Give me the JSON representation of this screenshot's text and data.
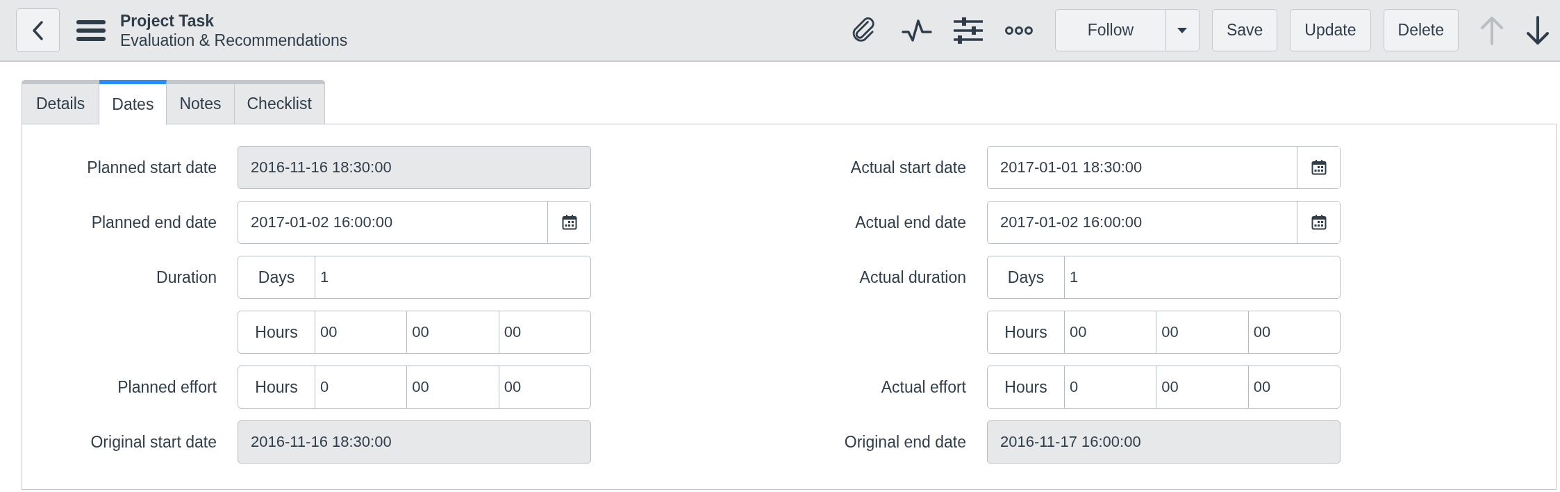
{
  "header": {
    "title": "Project Task",
    "subtitle": "Evaluation & Recommendations"
  },
  "follow": {
    "label": "Follow"
  },
  "buttons": [
    "Save",
    "Update",
    "Delete"
  ],
  "nav": [
    {
      "kind": "up",
      "disabled": true
    },
    {
      "kind": "down",
      "disabled": false
    }
  ],
  "tabs": [
    {
      "label": "Details",
      "selected": false
    },
    {
      "label": "Dates",
      "selected": true
    },
    {
      "label": "Notes",
      "selected": false
    },
    {
      "label": "Checklist",
      "selected": false
    }
  ],
  "columns": [
    {
      "rows": [
        {
          "kind": "readonly",
          "label": "Planned start date",
          "value": "2016-11-16 18:30:00"
        },
        {
          "kind": "date",
          "label": "Planned end date",
          "value": "2017-01-02 16:00:00"
        },
        {
          "kind": "days",
          "label": "Duration",
          "unit": "Days",
          "value": "1"
        },
        {
          "kind": "hours",
          "unit": "Hours",
          "values": [
            "00",
            "00",
            "00"
          ]
        },
        {
          "kind": "hours",
          "label": "Planned effort",
          "unit": "Hours",
          "values": [
            "0",
            "00",
            "00"
          ]
        },
        {
          "kind": "readonly",
          "label": "Original start date",
          "value": "2016-11-16 18:30:00"
        }
      ]
    },
    {
      "rows": [
        {
          "kind": "date",
          "label": "Actual start date",
          "value": "2017-01-01 18:30:00"
        },
        {
          "kind": "date",
          "label": "Actual end date",
          "value": "2017-01-02 16:00:00"
        },
        {
          "kind": "days",
          "label": "Actual duration",
          "unit": "Days",
          "value": "1"
        },
        {
          "kind": "hours",
          "unit": "Hours",
          "values": [
            "00",
            "00",
            "00"
          ]
        },
        {
          "kind": "hours",
          "label": "Actual effort",
          "unit": "Hours",
          "values": [
            "0",
            "00",
            "00"
          ]
        },
        {
          "kind": "readonly",
          "label": "Original end date",
          "value": "2016-11-17 16:00:00"
        }
      ]
    }
  ]
}
